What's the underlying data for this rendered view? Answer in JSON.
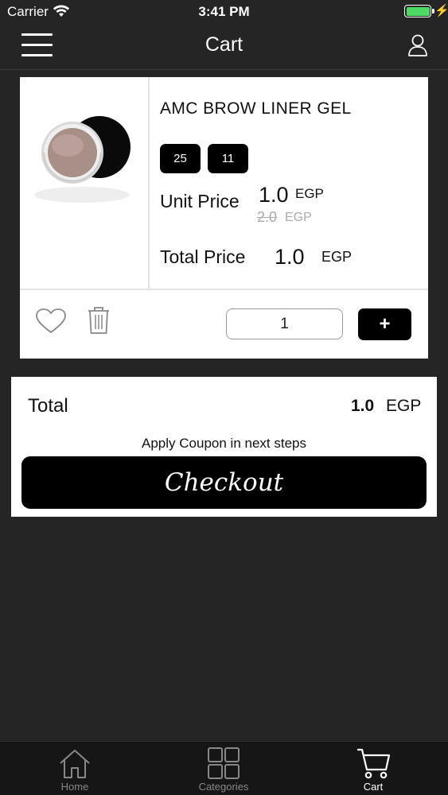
{
  "status_bar": {
    "carrier": "Carrier",
    "time": "3:41 PM",
    "battery_color": "#4cd964"
  },
  "nav": {
    "title": "Cart",
    "menu_icon": "hamburger-menu-icon",
    "profile_icon": "user-icon"
  },
  "cart_item": {
    "name": "AMC BROW LINER GEL",
    "variants": [
      "25",
      "11"
    ],
    "unit_price_label": "Unit Price",
    "unit_price": "1.0",
    "unit_price_currency": "EGP",
    "old_price": "2.0",
    "old_price_currency": "EGP",
    "total_price_label": "Total Price",
    "total_price": "1.0",
    "total_price_currency": "EGP",
    "quantity": "1",
    "plus_label": "+",
    "favorite_icon": "heart-icon",
    "delete_icon": "trash-icon"
  },
  "summary": {
    "total_label": "Total",
    "total_value": "1.0",
    "total_currency": "EGP",
    "coupon_note": "Apply Coupon in next steps",
    "checkout_label": "Checkout"
  },
  "tab_bar": {
    "tabs": [
      {
        "label": "Home",
        "icon": "home-icon",
        "active": false
      },
      {
        "label": "Categories",
        "icon": "grid-icon",
        "active": false
      },
      {
        "label": "Cart",
        "icon": "cart-icon",
        "active": true
      }
    ]
  },
  "colors": {
    "background": "#252526",
    "card": "#ffffff",
    "button": "#000000",
    "tab_bar": "#161616"
  }
}
